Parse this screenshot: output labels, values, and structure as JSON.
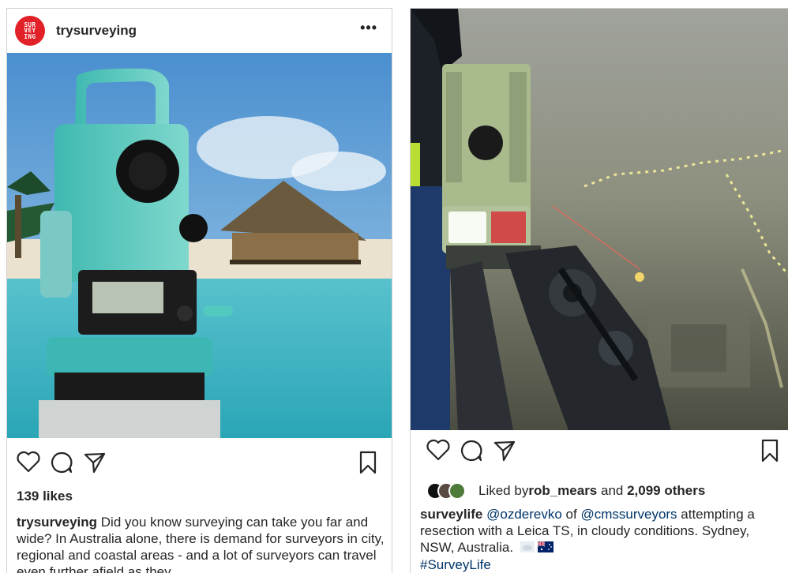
{
  "post1": {
    "username": "trysurveying",
    "avatar_lines": [
      "SUR",
      "VEY",
      "ING"
    ],
    "likes": "139 likes",
    "caption_user": "trysurveying",
    "caption_text": " Did you know surveying can take you far and wide? In Australia alone, there is demand for surveyors in city, regional and coastal areas - and a lot of surveyors can travel even further afield as they"
  },
  "post2": {
    "liked_by_prefix": "Liked by ",
    "liked_by_user": "rob_mears",
    "liked_by_mid": " and ",
    "liked_by_others": "2,099 others",
    "caption_user": "surveylife",
    "caption_mention1": "@ozderevko",
    "caption_of": " of ",
    "caption_mention2": "@cmssurveyors",
    "caption_text": " attempting a resection with a Leica TS, in cloudy conditions. Sydney, NSW, Australia. ",
    "caption_hashtag": "#SurveyLife"
  },
  "icons": {
    "more": "more-options-icon",
    "heart": "heart-icon",
    "comment": "comment-icon",
    "share": "share-icon",
    "bookmark": "bookmark-icon",
    "flag": "australia-flag-icon"
  },
  "colors": {
    "avatar_brand": "#e12127",
    "mention": "#003569",
    "text": "#262626"
  }
}
